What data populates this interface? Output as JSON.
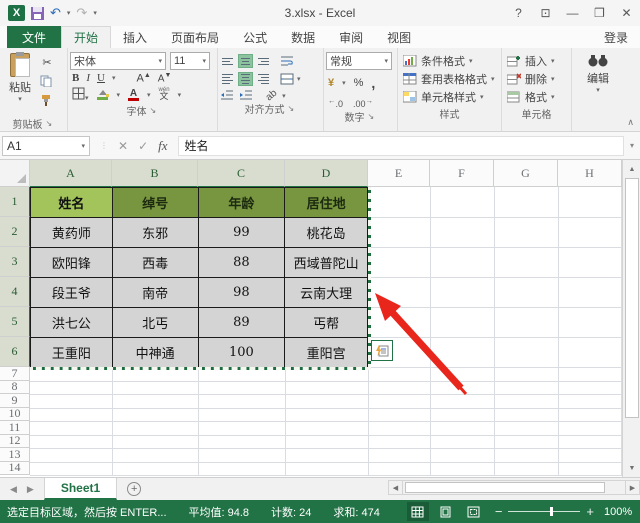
{
  "titlebar": {
    "title": "3.xlsx - Excel",
    "controls": {
      "help": "?",
      "ribbon_display": "⊡",
      "minimize": "—",
      "restore": "❒",
      "close": "✕"
    },
    "qat": {
      "excel_logo": "X",
      "undo": "↶",
      "redo": "↷",
      "dropdown": "▾",
      "customize": "▾"
    }
  },
  "tabs": {
    "file": "文件",
    "items": [
      "开始",
      "插入",
      "页面布局",
      "公式",
      "数据",
      "审阅",
      "视图"
    ],
    "active": "开始",
    "sign_in": "登录"
  },
  "ribbon": {
    "clipboard": {
      "label": "剪贴板",
      "paste": "粘贴"
    },
    "font": {
      "label": "字体",
      "font_name": "宋体",
      "font_size": "11",
      "bold": "B",
      "italic": "I",
      "underline": "U",
      "grow": "A",
      "shrink": "A",
      "font_color": "A",
      "phonetic": "文"
    },
    "alignment": {
      "label": "对齐方式",
      "orientation": "ab"
    },
    "number": {
      "label": "数字",
      "format": "常规",
      "accounting": "¥",
      "percent": "%",
      "comma": ",",
      "inc_decimal": ".0",
      "dec_decimal": ".00"
    },
    "styles": {
      "label": "样式",
      "items": [
        "条件格式",
        "套用表格格式",
        "单元格样式"
      ]
    },
    "cells": {
      "label": "单元格",
      "items": [
        "插入",
        "删除",
        "格式"
      ]
    },
    "editing": {
      "label": "编辑"
    }
  },
  "formula_bar": {
    "name_box": "A1",
    "fx": "fx",
    "value": "姓名"
  },
  "grid": {
    "columns": [
      "A",
      "B",
      "C",
      "D",
      "E",
      "F",
      "G",
      "H"
    ],
    "row_numbers": [
      "1",
      "2",
      "3",
      "4",
      "5",
      "6",
      "7",
      "8",
      "9",
      "10",
      "11",
      "12",
      "13",
      "14"
    ],
    "selection": "A1:D6",
    "table": {
      "headers": [
        "姓名",
        "绰号",
        "年龄",
        "居住地"
      ],
      "data": [
        [
          "黄药师",
          "东邪",
          "99",
          "桃花岛"
        ],
        [
          "欧阳锋",
          "西毒",
          "88",
          "西域普陀山"
        ],
        [
          "段王爷",
          "南帝",
          "98",
          "云南大理"
        ],
        [
          "洪七公",
          "北丐",
          "89",
          "丐帮"
        ],
        [
          "王重阳",
          "中神通",
          "100",
          "重阳宫"
        ]
      ]
    }
  },
  "sheet_bar": {
    "active_tab": "Sheet1",
    "add": "+"
  },
  "status_bar": {
    "message": "选定目标区域，然后按 ENTER...",
    "average": "平均值: 94.8",
    "count": "计数: 24",
    "sum": "求和: 474",
    "zoom_out": "−",
    "zoom_in": "+",
    "zoom_level": "100%"
  },
  "colors": {
    "excel_green": "#217346",
    "table_header_active_cell": "#a2c45b",
    "table_header": "#78963f",
    "selected_cell_fill": "#d4d4d4",
    "annotation_arrow": "#e8261b"
  }
}
